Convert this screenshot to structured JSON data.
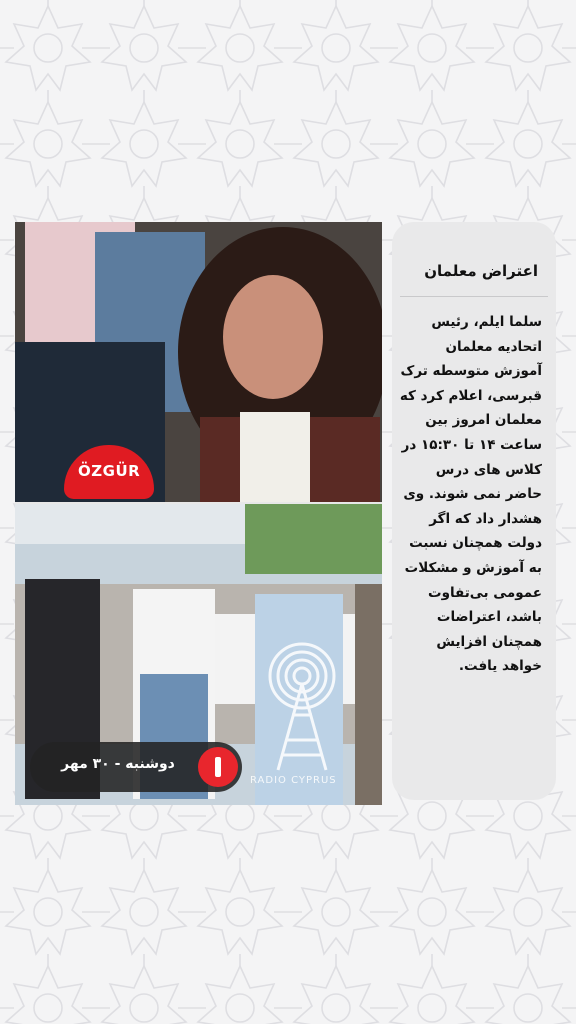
{
  "story": {
    "title": "اعتراض معلمان",
    "body": "سلما ایلم، رئیس اتحادیه معلمان آموزش متوسطه ترک قبرسی، اعلام کرد که معلمان امروز بین ساعت ۱۴ تا ۱۵:۳۰ در کلاس های درس حاضر نمی شوند. وی هشدار داد که اگر دولت همچنان نسبت به آموزش و مشکلات عمومی بی‌تفاوت باشد، اعتراضات همچنان افزایش خواهد یافت."
  },
  "media": {
    "mic_label": "ÖZGÜR",
    "date_label": "دوشنبه - ۳۰ مهر",
    "watermark": "RADIO CYPRUS"
  },
  "colors": {
    "accent_red": "#e8262d",
    "card_bg": "#e9e9ea",
    "page_bg": "#f4f4f5"
  }
}
